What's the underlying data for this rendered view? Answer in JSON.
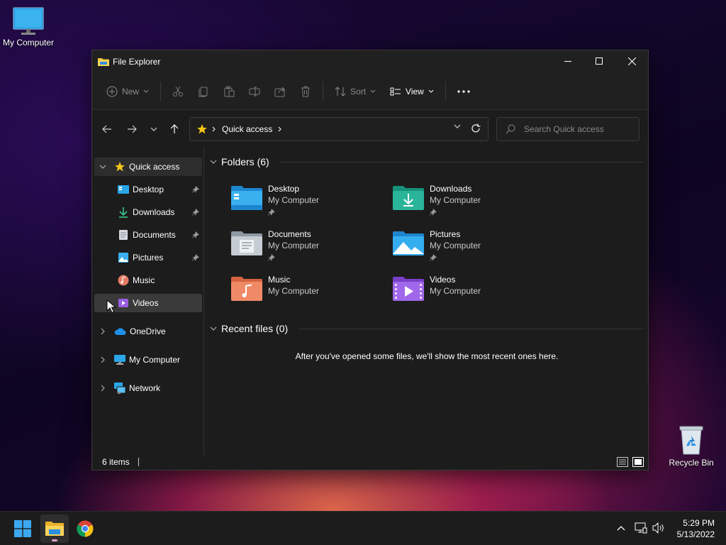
{
  "desktop": {
    "icons": [
      {
        "label": "My Computer"
      },
      {
        "label": "Recycle Bin"
      }
    ]
  },
  "window": {
    "title": "File Explorer",
    "toolbar": {
      "new_label": "New",
      "sort_label": "Sort",
      "view_label": "View"
    },
    "address": {
      "location": "Quick access"
    },
    "search": {
      "placeholder": "Search Quick access"
    },
    "sidebar": {
      "quick_access": "Quick access",
      "pinned": [
        {
          "label": "Desktop"
        },
        {
          "label": "Downloads"
        },
        {
          "label": "Documents"
        },
        {
          "label": "Pictures"
        },
        {
          "label": "Music"
        },
        {
          "label": "Videos"
        }
      ],
      "onedrive": "OneDrive",
      "my_computer": "My Computer",
      "network": "Network"
    },
    "content": {
      "folders_header": "Folders (6)",
      "folders": [
        {
          "name": "Desktop",
          "location": "My Computer",
          "pinned": true
        },
        {
          "name": "Downloads",
          "location": "My Computer",
          "pinned": true
        },
        {
          "name": "Documents",
          "location": "My Computer",
          "pinned": true
        },
        {
          "name": "Pictures",
          "location": "My Computer",
          "pinned": true
        },
        {
          "name": "Music",
          "location": "My Computer",
          "pinned": false
        },
        {
          "name": "Videos",
          "location": "My Computer",
          "pinned": false
        }
      ],
      "recent_header": "Recent files (0)",
      "recent_empty": "After you've opened some files, we'll show the most recent ones here."
    },
    "status": {
      "item_count": "6 items"
    }
  },
  "taskbar": {
    "clock_time": "5:29 PM",
    "clock_date": "5/13/2022"
  }
}
